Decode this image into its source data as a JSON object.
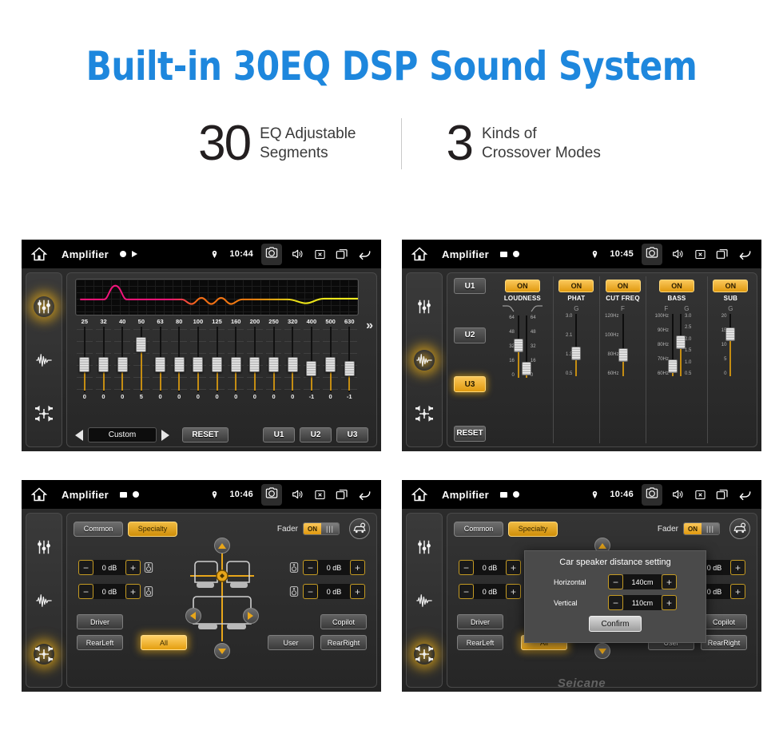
{
  "header": {
    "title": "Built-in 30EQ DSP Sound System",
    "title_color": "#1e87dd",
    "stats": [
      {
        "number": "30",
        "line1": "EQ Adjustable",
        "line2": "Segments"
      },
      {
        "number": "3",
        "line1": "Kinds of",
        "line2": "Crossover Modes"
      }
    ]
  },
  "colors": {
    "accent_orange": "#e8a61a",
    "screen_bg": "#262626",
    "status_bar": "#000000"
  },
  "screens": [
    {
      "id": "eq-screen",
      "statusbar": {
        "home": "home-icon",
        "title": "Amplifier",
        "mini_icons": [
          "record-dot-icon",
          "play-triangle-icon"
        ],
        "location": "location-pin-icon",
        "time": "10:44",
        "icons": [
          "camera-icon",
          "volume-icon",
          "mute-x-icon",
          "recents-icon",
          "back-icon"
        ]
      },
      "rail": [
        {
          "name": "equalizer-icon",
          "active": true
        },
        {
          "name": "waveform-icon",
          "active": false
        },
        {
          "name": "balance-icon",
          "active": false
        }
      ],
      "eq": {
        "frequencies": [
          "25",
          "32",
          "40",
          "50",
          "63",
          "80",
          "100",
          "125",
          "160",
          "200",
          "250",
          "320",
          "400",
          "500",
          "630"
        ],
        "values": [
          "0",
          "0",
          "0",
          "5",
          "0",
          "0",
          "0",
          "0",
          "0",
          "0",
          "0",
          "0",
          "-1",
          "0",
          "-1"
        ],
        "more_chevron": "»",
        "prev_arrow": "prev-preset-arrow",
        "next_arrow": "next-preset-arrow",
        "preset_name": "Custom",
        "reset_label": "RESET",
        "user_presets": [
          "U1",
          "U2",
          "U3"
        ]
      }
    },
    {
      "id": "crossover-screen",
      "statusbar": {
        "home": "home-icon",
        "title": "Amplifier",
        "mini_icons": [
          "image-icon",
          "record-dot-icon"
        ],
        "location": "location-pin-icon",
        "time": "10:45",
        "icons": [
          "camera-icon",
          "volume-icon",
          "mute-x-icon",
          "recents-icon",
          "back-icon"
        ]
      },
      "rail": [
        {
          "name": "equalizer-icon",
          "active": false
        },
        {
          "name": "waveform-icon",
          "active": true
        },
        {
          "name": "balance-icon",
          "active": false
        }
      ],
      "presets": [
        {
          "label": "U1",
          "active": false
        },
        {
          "label": "U2",
          "active": false
        },
        {
          "label": "U3",
          "active": true
        },
        {
          "label": "RESET",
          "active": false
        }
      ],
      "columns": [
        {
          "label": "LOUDNESS",
          "on_label": "ON",
          "sub": [
            "curve-down-icon",
            "curve-up-icon"
          ],
          "sliders": [
            {
              "scale": [
                "64",
                "48",
                "32",
                "16",
                "0"
              ],
              "scale_side": "left",
              "pos_pct": 52
            },
            {
              "scale": [
                "64",
                "48",
                "32",
                "16",
                "0"
              ],
              "scale_side": "right",
              "pos_pct": 5
            }
          ]
        },
        {
          "label": "PHAT",
          "on_label": "ON",
          "sub": [
            "G"
          ],
          "sliders": [
            {
              "scale": [
                "3.0",
                "2.1",
                "1.3",
                "0.5"
              ],
              "scale_side": "left",
              "pos_pct": 32
            }
          ]
        },
        {
          "label": "CUT FREQ",
          "on_label": "ON",
          "sub": [
            "F"
          ],
          "sliders": [
            {
              "scale": [
                "120Hz",
                "100Hz",
                "80Hz",
                "60Hz"
              ],
              "scale_side": "left",
              "pos_pct": 30
            }
          ]
        },
        {
          "label": "BASS",
          "on_label": "ON",
          "sub": [
            "F",
            "G"
          ],
          "sliders": [
            {
              "scale": [
                "100Hz",
                "90Hz",
                "80Hz",
                "70Hz",
                "60Hz"
              ],
              "scale_side": "left",
              "pos_pct": 6
            },
            {
              "scale": [
                "3.0",
                "2.5",
                "2.0",
                "1.5",
                "1.0",
                "0.5"
              ],
              "scale_side": "right",
              "pos_pct": 56
            }
          ]
        },
        {
          "label": "SUB",
          "on_label": "ON",
          "sub": [
            "G"
          ],
          "sliders": [
            {
              "scale": [
                "20",
                "15",
                "10",
                "5",
                "0"
              ],
              "scale_side": "left",
              "pos_pct": 72
            }
          ]
        }
      ]
    },
    {
      "id": "fader-screen",
      "statusbar": {
        "home": "home-icon",
        "title": "Amplifier",
        "mini_icons": [
          "image-icon",
          "record-dot-icon"
        ],
        "location": "location-pin-icon",
        "time": "10:46",
        "icons": [
          "camera-icon",
          "volume-icon",
          "mute-x-icon",
          "recents-icon",
          "back-icon"
        ]
      },
      "rail": [
        {
          "name": "equalizer-icon",
          "active": false
        },
        {
          "name": "waveform-icon",
          "active": false
        },
        {
          "name": "balance-icon",
          "active": true
        }
      ],
      "tabs": [
        {
          "label": "Common",
          "active": false
        },
        {
          "label": "Specialty",
          "active": true
        }
      ],
      "fader": {
        "label": "Fader",
        "toggle_on_label": "ON",
        "toggle_state": "on"
      },
      "car_setting_icon": "car-settings-icon",
      "gains": [
        {
          "position": "front-left",
          "minus": "−",
          "value": "0 dB",
          "plus": "+"
        },
        {
          "position": "front-right",
          "minus": "−",
          "value": "0 dB",
          "plus": "+"
        },
        {
          "position": "rear-left",
          "minus": "−",
          "value": "0 dB",
          "plus": "+"
        },
        {
          "position": "rear-right",
          "minus": "−",
          "value": "0 dB",
          "plus": "+"
        }
      ],
      "position_buttons": [
        {
          "label": "Driver",
          "active": false
        },
        {
          "label": "Copilot",
          "active": false
        },
        {
          "label": "RearLeft",
          "active": false
        },
        {
          "label": "All",
          "active": true
        },
        {
          "label": "User",
          "active": false
        },
        {
          "label": "RearRight",
          "active": false
        }
      ],
      "dialog": null,
      "watermark": null
    },
    {
      "id": "distance-dialog-screen",
      "statusbar": {
        "home": "home-icon",
        "title": "Amplifier",
        "mini_icons": [
          "image-icon",
          "record-dot-icon"
        ],
        "location": "location-pin-icon",
        "time": "10:46",
        "icons": [
          "camera-icon",
          "volume-icon",
          "mute-x-icon",
          "recents-icon",
          "back-icon"
        ]
      },
      "rail": [
        {
          "name": "equalizer-icon",
          "active": false
        },
        {
          "name": "waveform-icon",
          "active": false
        },
        {
          "name": "balance-icon",
          "active": true
        }
      ],
      "tabs": [
        {
          "label": "Common",
          "active": false
        },
        {
          "label": "Specialty",
          "active": true
        }
      ],
      "fader": {
        "label": "Fader",
        "toggle_on_label": "ON",
        "toggle_state": "on"
      },
      "car_setting_icon": "car-settings-icon",
      "gains": [
        {
          "position": "front-left",
          "minus": "−",
          "value": "0 dB",
          "plus": "+"
        },
        {
          "position": "front-right",
          "minus": "−",
          "value": "0 dB",
          "plus": "+"
        },
        {
          "position": "rear-left",
          "minus": "−",
          "value": "0 dB",
          "plus": "+"
        },
        {
          "position": "rear-right",
          "minus": "−",
          "value": "0 dB",
          "plus": "+"
        }
      ],
      "position_buttons": [
        {
          "label": "Driver",
          "active": false
        },
        {
          "label": "Copilot",
          "active": false
        },
        {
          "label": "RearLeft",
          "active": false
        },
        {
          "label": "All",
          "active": true
        },
        {
          "label": "User",
          "active": false
        },
        {
          "label": "RearRight",
          "active": false
        }
      ],
      "dialog": {
        "title": "Car speaker distance setting",
        "rows": [
          {
            "label": "Horizontal",
            "minus": "−",
            "value": "140cm",
            "plus": "+"
          },
          {
            "label": "Vertical",
            "minus": "−",
            "value": "110cm",
            "plus": "+"
          }
        ],
        "confirm_label": "Confirm"
      },
      "watermark": "Seicane"
    }
  ]
}
